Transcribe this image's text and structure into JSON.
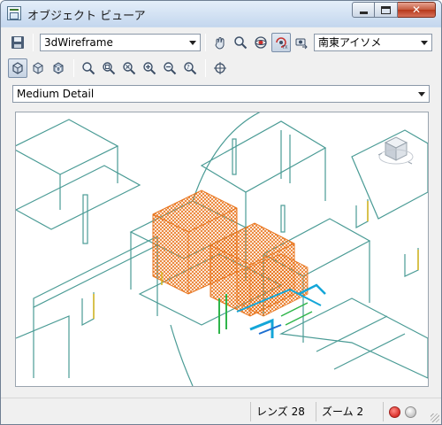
{
  "window": {
    "title": "オブジェクト ビューア"
  },
  "toolbar1": {
    "visual_style": "3dWireframe",
    "view": "南東アイソメ"
  },
  "toolbar2": {},
  "detail_level": "Medium Detail",
  "status": {
    "lens": "レンズ 28",
    "zoom": "ズーム 2"
  },
  "colors": {
    "wire": "#3f8f8a",
    "hatch": "#e8731a",
    "accent": "#14a6d8",
    "green": "#2fb54a"
  }
}
